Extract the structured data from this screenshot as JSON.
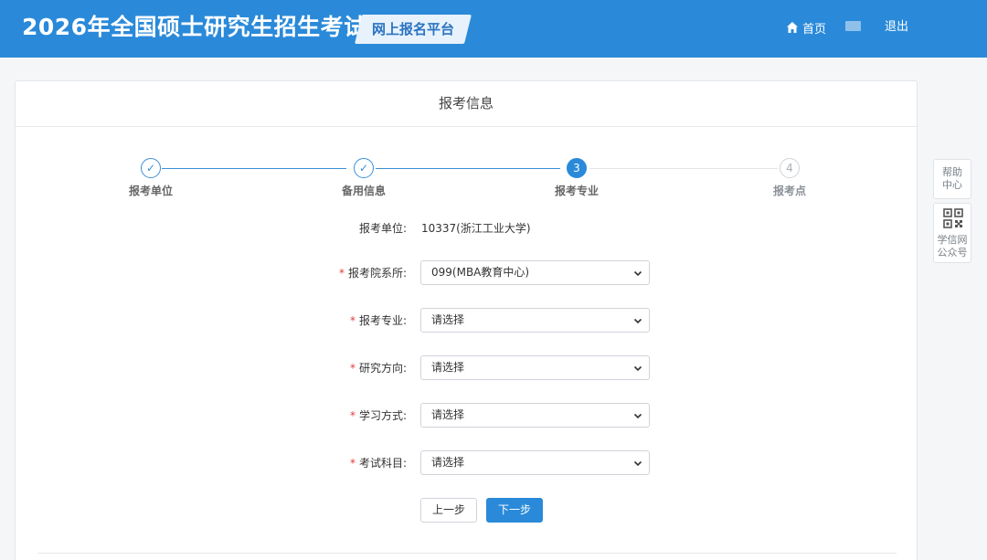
{
  "header": {
    "title": "2026年全国硕士研究生招生考试",
    "platform": "网上报名平台",
    "home_label": "首页",
    "logout_label": "退出"
  },
  "card": {
    "title": "报考信息"
  },
  "steps": [
    {
      "number": "✓",
      "label": "报考单位",
      "state": "done"
    },
    {
      "number": "✓",
      "label": "备用信息",
      "state": "done"
    },
    {
      "number": "3",
      "label": "报考专业",
      "state": "active"
    },
    {
      "number": "4",
      "label": "报考点",
      "state": "todo"
    }
  ],
  "form": {
    "unit": {
      "label": "报考单位:",
      "value": "10337(浙江工业大学)"
    },
    "department": {
      "label": "报考院系所:",
      "required_mark": "*",
      "selected": "099(MBA教育中心)"
    },
    "major": {
      "label": "报考专业:",
      "required_mark": "*",
      "selected": "请选择"
    },
    "direction": {
      "label": "研究方向:",
      "required_mark": "*",
      "selected": "请选择"
    },
    "study_mode": {
      "label": "学习方式:",
      "required_mark": "*",
      "selected": "请选择"
    },
    "subjects": {
      "label": "考试科目:",
      "required_mark": "*",
      "selected": "请选择"
    }
  },
  "buttons": {
    "prev": "上一步",
    "next": "下一步"
  },
  "side": {
    "help_line1": "帮助",
    "help_line2": "中心",
    "qr_line1": "学信网",
    "qr_line2": "公众号"
  },
  "colors": {
    "header_bg": "#2a8ad9",
    "accent": "#2a8ad9",
    "required": "#e23b3b"
  },
  "icons": [
    "home-icon",
    "flag-icon",
    "check-icon",
    "chevron-down-icon",
    "qr-code-icon"
  ]
}
